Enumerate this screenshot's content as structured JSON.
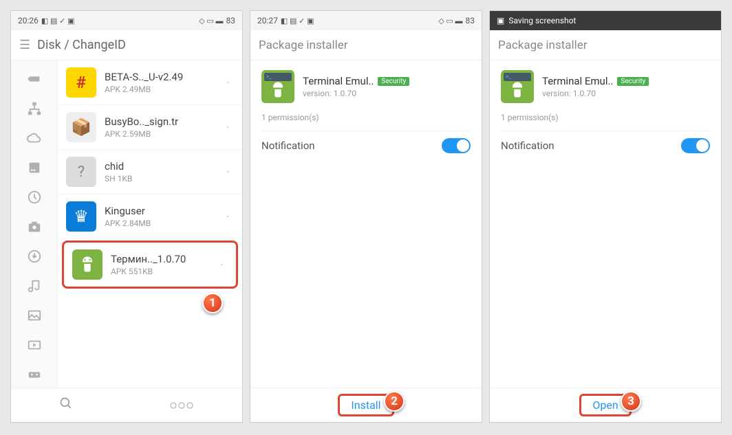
{
  "pane1": {
    "status": {
      "time": "20:26",
      "battery": "83"
    },
    "breadcrumb": "Disk / ChangeID",
    "files": [
      {
        "name": "BETA-S.._U-v2.49",
        "meta": "APK 2.49MB"
      },
      {
        "name": "BusyBo.._sign.tr",
        "meta": "APK 2.59MB"
      },
      {
        "name": "chid",
        "meta": "SH 1KB"
      },
      {
        "name": "Kinguser",
        "meta": "APK 2.84MB"
      },
      {
        "name": "Термин.._1.0.70",
        "meta": "APK 551KB"
      }
    ],
    "step": "1"
  },
  "pane2": {
    "status": {
      "time": "20:27",
      "battery": "83"
    },
    "title": "Package installer",
    "app": {
      "name": "Terminal Emul..",
      "badge": "Security",
      "version": "version: 1.0.70"
    },
    "perm_count": "1 permission(s)",
    "perm_label": "Notification",
    "action": "Install",
    "step": "2"
  },
  "pane3": {
    "saving_text": "Saving screenshot",
    "title": "Package installer",
    "app": {
      "name": "Terminal Emul..",
      "badge": "Security",
      "version": "version: 1.0.70"
    },
    "perm_count": "1 permission(s)",
    "perm_label": "Notification",
    "action": "Open",
    "step": "3"
  }
}
